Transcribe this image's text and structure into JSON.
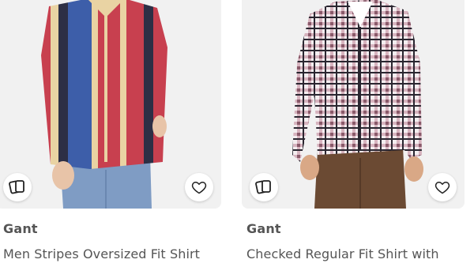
{
  "products": [
    {
      "brand": "Gant",
      "title": "Men Stripes Oversized Fit Shirt",
      "icons": {
        "compare": "compare-cards-icon",
        "wishlist": "heart-icon"
      },
      "colors": {
        "red": "#c8404f",
        "blue": "#3d5ea9",
        "cream": "#e9d3a3",
        "navy": "#2d2f45",
        "jeans": "#7f9cc4"
      }
    },
    {
      "brand": "Gant",
      "title": "Checked Regular Fit Shirt with",
      "icons": {
        "compare": "compare-cards-icon",
        "wishlist": "heart-icon"
      },
      "colors": {
        "check_dark": "#2a2630",
        "check_pink": "#d7b4bf",
        "check_white": "#f4eef0",
        "pants": "#6b4a33"
      }
    }
  ],
  "colors": {
    "card_bg": "#f1f1f1",
    "text": "#555555"
  }
}
